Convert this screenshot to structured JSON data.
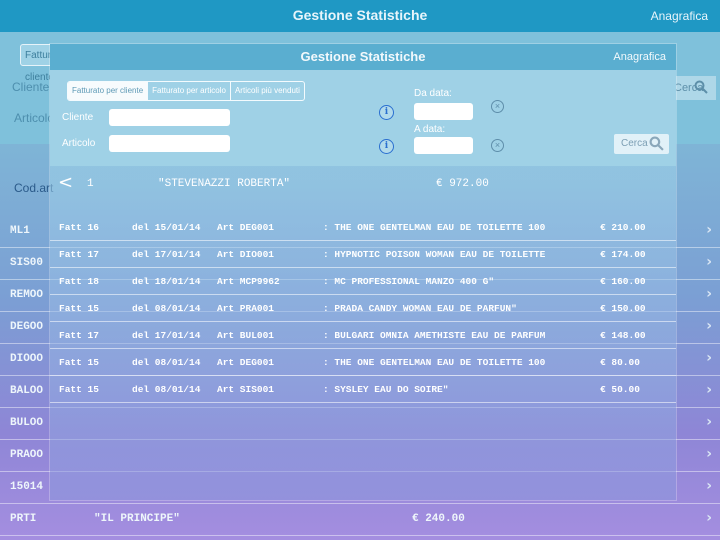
{
  "background": {
    "header": {
      "title": "Gestione Statistiche",
      "nav_right": "Anagrafica"
    },
    "first_tab": "Fatturato per cliente",
    "labels": {
      "customer": "Cliente",
      "article": "Articolo",
      "code_col": "Cod.art"
    },
    "search_label": "Cerca",
    "rows": [
      {
        "code": "ML1",
        "name": "",
        "amount": ""
      },
      {
        "code": "SIS00",
        "name": "",
        "amount": ""
      },
      {
        "code": "REMOO",
        "name": "",
        "amount": ""
      },
      {
        "code": "DEGOO",
        "name": "",
        "amount": ""
      },
      {
        "code": "DIOOO",
        "name": "",
        "amount": ""
      },
      {
        "code": "BALOO",
        "name": "",
        "amount": ""
      },
      {
        "code": "BULOO",
        "name": "",
        "amount": ""
      },
      {
        "code": "PRAOO",
        "name": "",
        "amount": ""
      },
      {
        "code": "15014",
        "name": "",
        "amount": ""
      },
      {
        "code": "PRTI",
        "name": "\"IL PRINCIPE\"",
        "amount": "€ 240.00"
      }
    ]
  },
  "modal": {
    "header": {
      "title": "Gestione Statistiche",
      "nav_right": "Anagrafica"
    },
    "tabs": [
      "Fatturato per cliente",
      "Fatturato per articolo",
      "Articoli più venduti"
    ],
    "active_tab": 0,
    "fields": {
      "customer_label": "Cliente",
      "article_label": "Articolo",
      "from_label": "Da data:",
      "to_label": "A data:",
      "customer_value": "",
      "article_value": "",
      "from_value": "",
      "to_value": ""
    },
    "search_label": "Cerca",
    "summary": {
      "number": "1",
      "customer": "\"STEVENAZZI ROBERTA\"",
      "total": "€ 972.00"
    },
    "invoices": [
      {
        "fatt": "Fatt 16",
        "del": "del 15/01/14",
        "art": "Art DEG001",
        "desc": ": THE ONE GENTELMAN EAU DE TOILETTE 100",
        "amount": "€ 210.00"
      },
      {
        "fatt": "Fatt 17",
        "del": "del 17/01/14",
        "art": "Art DIO001",
        "desc": ": HYPNOTIC POISON WOMAN EAU DE TOILETTE",
        "amount": "€ 174.00"
      },
      {
        "fatt": "Fatt 18",
        "del": "del 18/01/14",
        "art": "Art MCP9962",
        "desc": ": MC PROFESSIONAL MANZO 400 G\"",
        "amount": "€ 160.00"
      },
      {
        "fatt": "Fatt 15",
        "del": "del 08/01/14",
        "art": "Art PRA001",
        "desc": ": PRADA CANDY WOMAN EAU DE PARFUN\"",
        "amount": "€ 150.00"
      },
      {
        "fatt": "Fatt 17",
        "del": "del 17/01/14",
        "art": "Art BUL001",
        "desc": ": BULGARI OMNIA AMETHISTE EAU DE PARFUM",
        "amount": "€ 148.00"
      },
      {
        "fatt": "Fatt 15",
        "del": "del 08/01/14",
        "art": "Art DEG001",
        "desc": ": THE ONE GENTELMAN EAU DE TOILETTE 100",
        "amount": "€ 80.00"
      },
      {
        "fatt": "Fatt 15",
        "del": "del 08/01/14",
        "art": "Art SIS001",
        "desc": ": SYSLEY EAU DO SOIRE\"",
        "amount": "€ 50.00"
      }
    ]
  },
  "colors": {
    "header_bg": "#1f98c4",
    "modal_header_bg": "#5aaed0",
    "filter_bg": "#9fd1e6",
    "info_icon": "#2a6fd0"
  },
  "icons": {
    "back": "chevron-left-icon",
    "info": "info-icon",
    "clear": "clear-icon",
    "search": "search-icon",
    "row_chevron": "chevron-right-icon"
  }
}
